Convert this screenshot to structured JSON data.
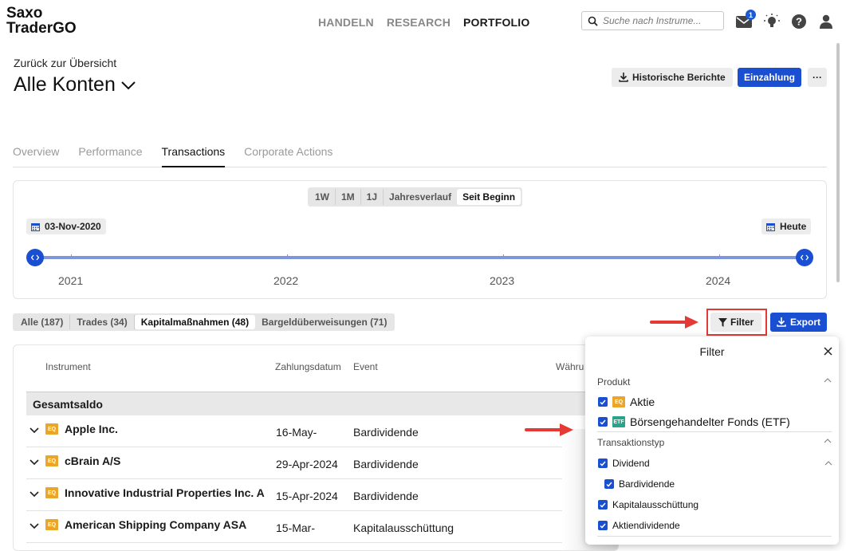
{
  "app": {
    "logo_line1": "Saxo",
    "logo_line2": "TraderGO"
  },
  "topnav": {
    "items": [
      "HANDELN",
      "RESEARCH",
      "PORTFOLIO"
    ],
    "active": "PORTFOLIO"
  },
  "search": {
    "placeholder": "Suche nach Instrume..."
  },
  "notifications": {
    "count": "1"
  },
  "header": {
    "back_link": "Zurück zur Übersicht",
    "title": "Alle Konten",
    "historical_reports_label": "Historische Berichte",
    "deposit_label": "Einzahlung",
    "more_label": "···"
  },
  "tabs": [
    "Overview",
    "Performance",
    "Transactions",
    "Corporate Actions"
  ],
  "active_tab": "Transactions",
  "timeline": {
    "periods": [
      "1W",
      "1M",
      "1J",
      "Jahresverlauf",
      "Seit Beginn"
    ],
    "active_period": "Seit Beginn",
    "start_date": "03-Nov-2020",
    "end_date": "Heute",
    "years": [
      "2021",
      "2022",
      "2023",
      "2024"
    ]
  },
  "segments": [
    "Alle (187)",
    "Trades (34)",
    "Kapitalmaßnahmen (48)",
    "Bargeldüberweisungen (71)"
  ],
  "active_segment": "Kapitalmaßnahmen (48)",
  "actions": {
    "filter_label": "Filter",
    "export_label": "Export"
  },
  "table": {
    "headers": {
      "instrument": "Instrument",
      "payment_date": "Zahlungsdatum",
      "event": "Event",
      "currency": "Währu"
    },
    "total_label": "Gesamtsaldo",
    "rows": [
      {
        "badge": "EQ",
        "name": "Apple Inc.",
        "date": "16-May-",
        "event": "Bardividende"
      },
      {
        "badge": "EQ",
        "name": "cBrain A/S",
        "date": "29-Apr-2024",
        "event": "Bardividende"
      },
      {
        "badge": "EQ",
        "name": "Innovative Industrial Properties Inc. A",
        "date": "15-Apr-2024",
        "event": "Bardividende"
      },
      {
        "badge": "EQ",
        "name": "American Shipping Company ASA",
        "date": "15-Mar-",
        "event": "Kapitalausschüttung"
      }
    ]
  },
  "filter_panel": {
    "title": "Filter",
    "product_section": "Produkt",
    "products": [
      {
        "badge": "EQ",
        "label": "Aktie",
        "checked": true
      },
      {
        "badge": "ETF",
        "label": "Börsengehandelter Fonds (ETF)",
        "checked": true
      }
    ],
    "transaction_section": "Transaktionstyp",
    "dividend_label": "Dividend",
    "cash_dividend_label": "Bardividende",
    "capital_distribution_label": "Kapitalausschüttung",
    "stock_dividend_label": "Aktiendividende"
  },
  "colors": {
    "accent": "#1a4fd1",
    "highlight": "#e53935",
    "eq_badge": "#e9a62b",
    "etf_badge": "#2aa38b"
  }
}
